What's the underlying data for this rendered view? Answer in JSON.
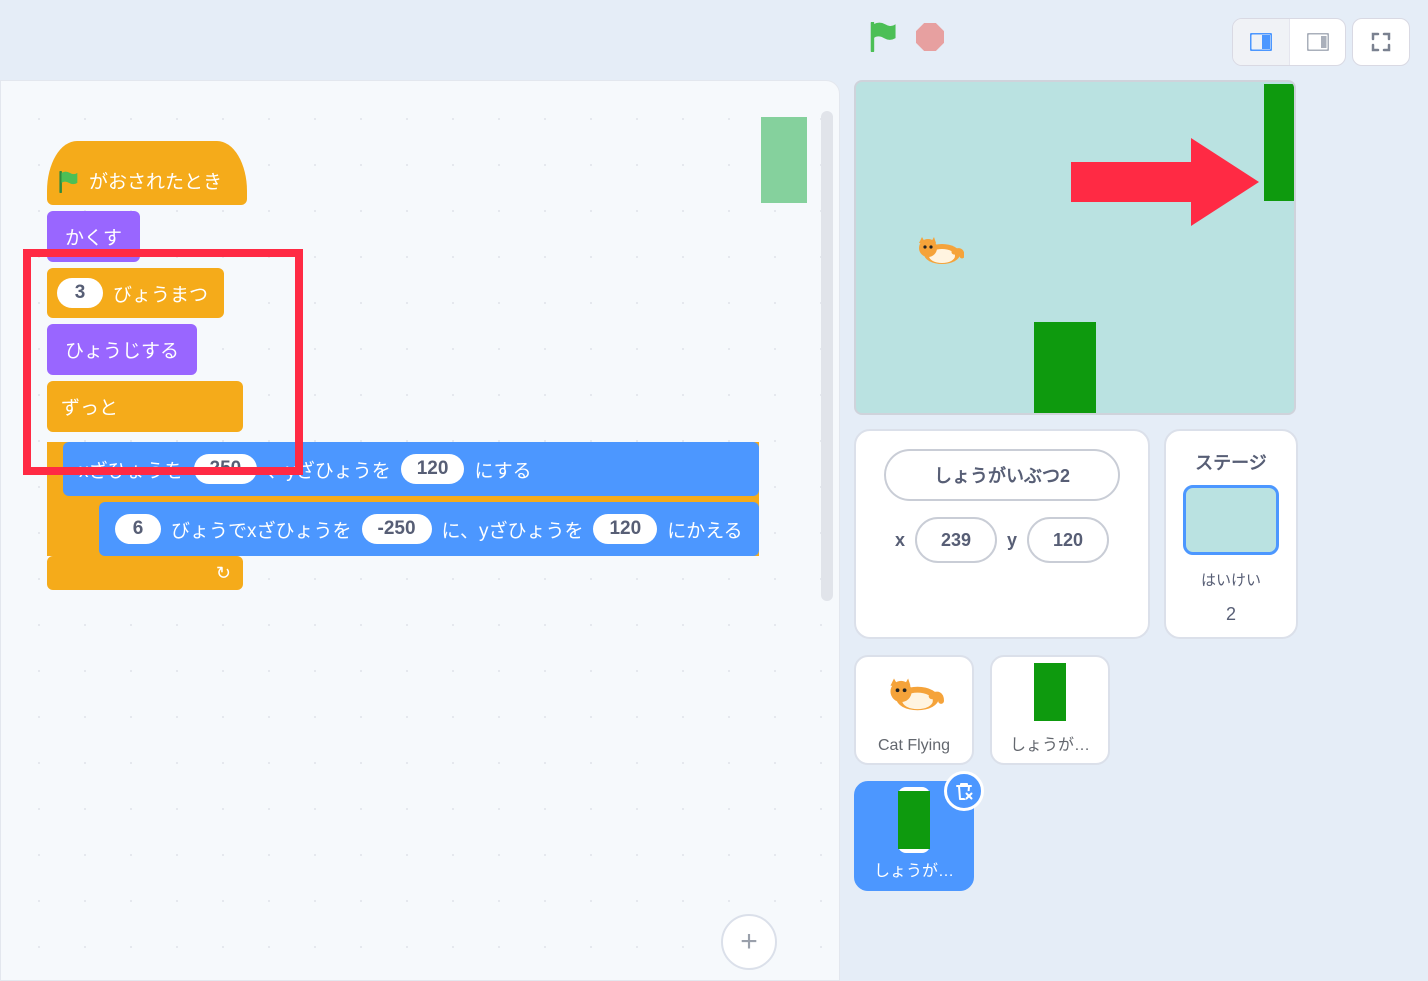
{
  "blocks": {
    "hat_label": "がおされたとき",
    "hide_label": "かくす",
    "wait_value": "3",
    "wait_label": "びょうまつ",
    "show_label": "ひょうじする",
    "forever_label": "ずっと",
    "goto_pre": "xざひょうを",
    "goto_x": "250",
    "goto_mid": "、yざひょうを",
    "goto_y": "120",
    "goto_post": "にする",
    "glide_secs": "6",
    "glide_pre": "びょうでxざひょうを",
    "glide_x": "-250",
    "glide_mid": "に、yざひょうを",
    "glide_y": "120",
    "glide_post": "にかえる"
  },
  "sprite_info": {
    "name": "しょうがいぶつ2",
    "x_label": "x",
    "x_value": "239",
    "y_label": "y",
    "y_value": "120"
  },
  "sprites": {
    "cat_flying": "Cat Flying",
    "obstacle1": "しょうが…",
    "obstacle2": "しょうが…"
  },
  "stage_panel": {
    "title": "ステージ",
    "backdrop_label": "はいけい",
    "backdrop_count": "2"
  }
}
